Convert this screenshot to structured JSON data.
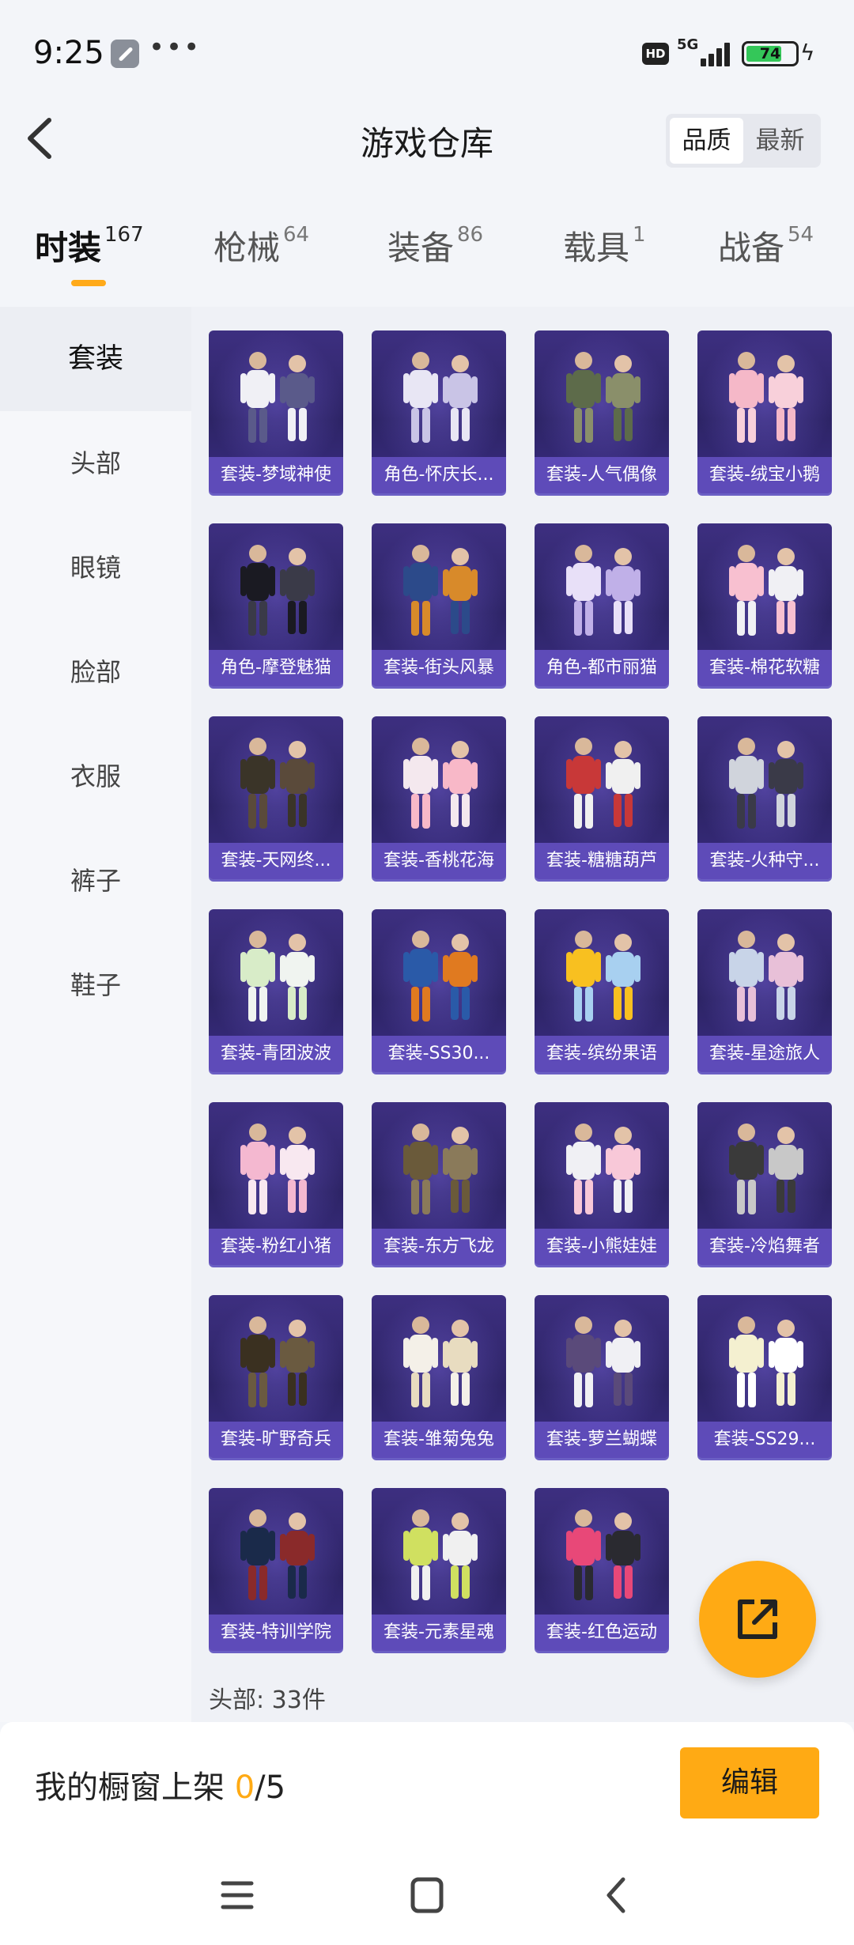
{
  "status_bar": {
    "time": "9:25",
    "network": "5G",
    "hd": "HD",
    "battery": "74",
    "battery_level": 0.74,
    "icons": [
      "wrench-icon",
      "more-icon",
      "signal-icon",
      "battery-icon",
      "charging-icon"
    ]
  },
  "header": {
    "title": "游戏仓库",
    "sort_options": [
      "品质",
      "最新"
    ],
    "active_sort": "品质"
  },
  "tabs": [
    {
      "label": "时装",
      "count": "167",
      "active": true
    },
    {
      "label": "枪械",
      "count": "64"
    },
    {
      "label": "装备",
      "count": "86"
    },
    {
      "label": "载具",
      "count": "1"
    },
    {
      "label": "战备",
      "count": "54"
    }
  ],
  "sidebar": {
    "items": [
      "套装",
      "头部",
      "眼镜",
      "脸部",
      "衣服",
      "裤子",
      "鞋子"
    ],
    "active": "套装"
  },
  "items": [
    {
      "label": "套装-梦域神使"
    },
    {
      "label": "角色-怀庆长..."
    },
    {
      "label": "套装-人气偶像"
    },
    {
      "label": "套装-绒宝小鹅"
    },
    {
      "label": "角色-摩登魅猫"
    },
    {
      "label": "套装-街头风暴"
    },
    {
      "label": "角色-都市丽猫"
    },
    {
      "label": "套装-棉花软糖"
    },
    {
      "label": "套装-天网终..."
    },
    {
      "label": "套装-香桃花海"
    },
    {
      "label": "套装-糖糖葫芦"
    },
    {
      "label": "套装-火种守..."
    },
    {
      "label": "套装-青团波波"
    },
    {
      "label": "套装-SS30..."
    },
    {
      "label": "套装-缤纷果语"
    },
    {
      "label": "套装-星途旅人"
    },
    {
      "label": "套装-粉红小猪"
    },
    {
      "label": "套装-东方飞龙"
    },
    {
      "label": "套装-小熊娃娃"
    },
    {
      "label": "套装-冷焰舞者"
    },
    {
      "label": "套装-旷野奇兵"
    },
    {
      "label": "套装-雏菊兔兔"
    },
    {
      "label": "套装-萝兰蝴蝶"
    },
    {
      "label": "套装-SS29..."
    },
    {
      "label": "套装-特训学院"
    },
    {
      "label": "套装-元素星魂"
    },
    {
      "label": "套装-红色运动"
    }
  ],
  "count_text": "头部: 33件",
  "shelf": {
    "label": "我的橱窗上架",
    "current": "0",
    "total": "/5",
    "edit_label": "编辑"
  },
  "nav": [
    "menu-icon",
    "home-icon",
    "back-icon"
  ],
  "colors": {
    "accent": "#ffaa14",
    "card_bg": "#2d2466",
    "card_label_bg": "#624ebe"
  }
}
